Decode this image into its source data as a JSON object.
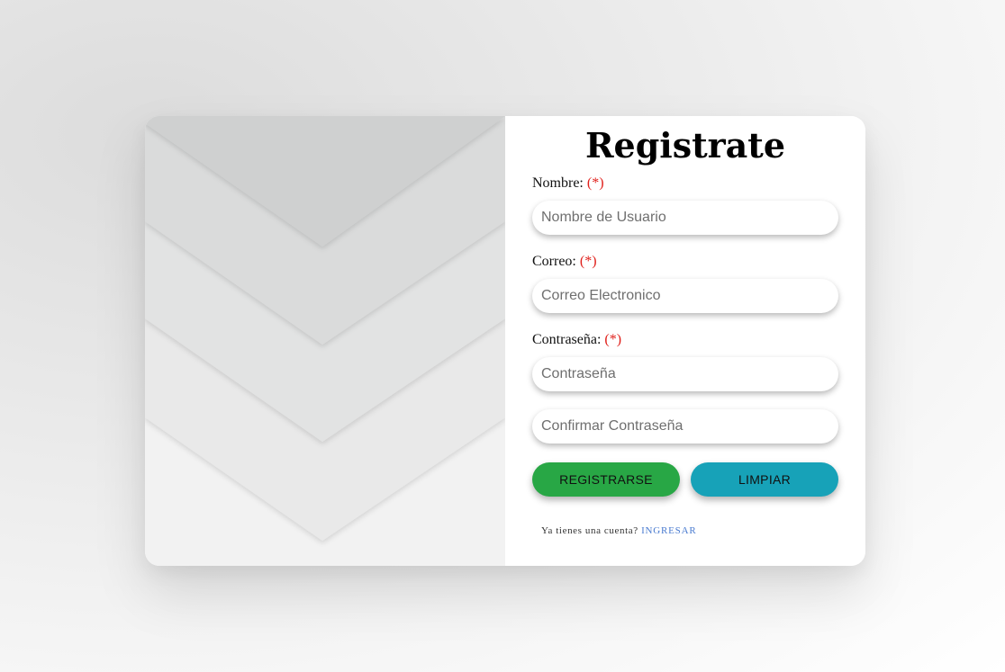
{
  "form": {
    "title": "Registrate",
    "name_label": "Nombre:",
    "email_label": "Correo:",
    "password_label": "Contraseña:",
    "required_mark": "(*)",
    "name_placeholder": "Nombre de Usuario",
    "email_placeholder": "Correo Electronico",
    "password_placeholder": "Contraseña",
    "confirm_placeholder": "Confirmar Contraseña",
    "register_button": "REGISTRARSE",
    "clear_button": "LIMPIAR",
    "footer_prompt": "Ya tienes una cuenta?",
    "login_link": "INGRESAR"
  },
  "colors": {
    "register_button": "#28a745",
    "clear_button": "#17a2b8",
    "required_mark": "#e0201b",
    "login_link": "#4a7bd0"
  }
}
